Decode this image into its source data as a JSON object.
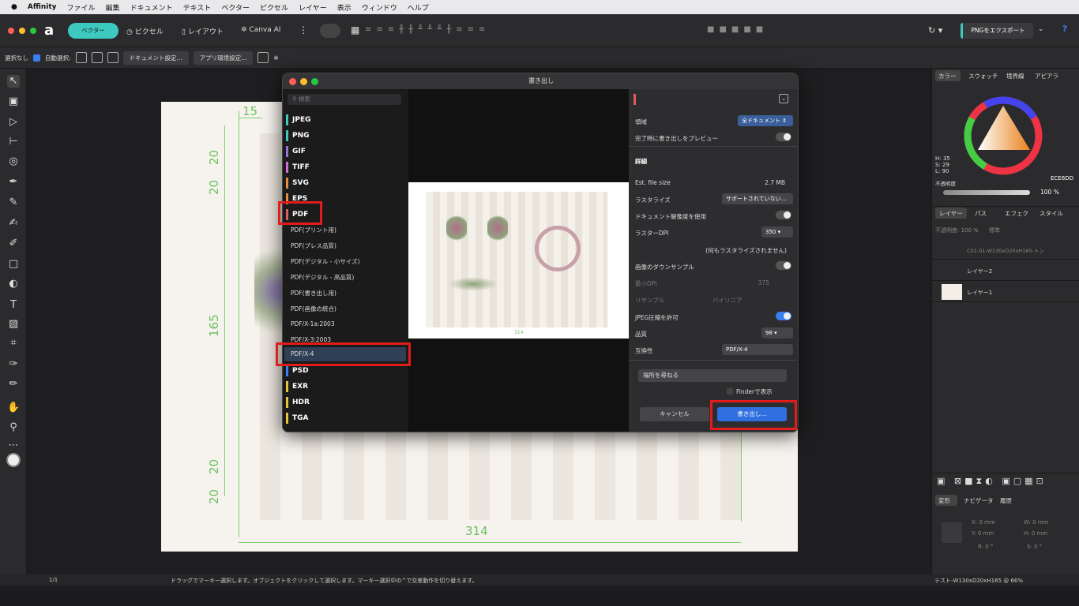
{
  "menubar": {
    "apple": "",
    "app": "Affinity",
    "items": [
      "ファイル",
      "編集",
      "ドキュメント",
      "テキスト",
      "ベクター",
      "ピクセル",
      "レイヤー",
      "表示",
      "ウィンドウ",
      "ヘルプ"
    ]
  },
  "toolbar": {
    "vector": "ベクター",
    "pixel": "ピクセル",
    "layout": "レイアウト",
    "canva": "Canva AI",
    "export": "PNGをエクスポート"
  },
  "context": {
    "select": "選択なし",
    "auto": "自動選択:",
    "docsettings": "ドキュメント設定...",
    "prefs": "アプリ環境設定..."
  },
  "canvas": {
    "dim_left_top": "15",
    "dim_20a": "20",
    "dim_20b": "20",
    "dim_165": "165",
    "dim_20c": "20",
    "dim_20d": "20",
    "dim_bottom": "314"
  },
  "dialog": {
    "title": "書き出し",
    "search_placeholder": "検索",
    "formats": [
      {
        "label": "JPEG",
        "color": "#3ec9c0"
      },
      {
        "label": "PNG",
        "color": "#3ec9c0"
      },
      {
        "label": "GIF",
        "color": "#9b6be0"
      },
      {
        "label": "TIFF",
        "color": "#d46bd8"
      },
      {
        "label": "SVG",
        "color": "#e88b3c"
      },
      {
        "label": "EPS",
        "color": "#e88b3c"
      },
      {
        "label": "PDF",
        "color": "#e05d5d"
      }
    ],
    "pdf_presets": [
      "PDF(プリント用)",
      "PDF(プレス品質)",
      "PDF(デジタル - 小サイズ)",
      "PDF(デジタル - 高品質)",
      "PDF(書き出し用)",
      "PDF(画像の統合)",
      "PDF/X-1a:2003",
      "PDF/X-3:2003",
      "PDF/X-4"
    ],
    "formats_after": [
      {
        "label": "PSD",
        "color": "#3a7ff0"
      },
      {
        "label": "EXR",
        "color": "#e8c23c"
      },
      {
        "label": "HDR",
        "color": "#e8c23c"
      },
      {
        "label": "TGA",
        "color": "#e8c23c"
      }
    ],
    "preview_dim": "314",
    "settings": {
      "area_label": "領域",
      "area_value": "全ドキュメント",
      "preview_label": "完了時に書き出しをプレビュー",
      "details": "詳細",
      "filesize_label": "Est. file size",
      "filesize_value": "2.7 MB",
      "rasterize_label": "ラスタライズ",
      "rasterize_value": "サポートされていない…",
      "docres_label": "ドキュメント解像度を使用",
      "dpi_label": "ラスターDPI",
      "dpi_value": "350",
      "norast": "(何もラスタライズされません)",
      "downsample_label": "画像のダウンサンプル",
      "mindpi_label": "最小DPI",
      "mindpi_value": "375",
      "resample_label": "リサンプル",
      "resample_value": "バイリニア",
      "jpeg_label": "JPEG圧縮を許可",
      "quality_label": "品質",
      "quality_value": "98",
      "compat_label": "互換性",
      "compat_value": "PDF/X-4",
      "ask_place": "場所を尋ねる",
      "finder": "Finderで表示",
      "cancel": "キャンセル",
      "export": "書き出し..."
    }
  },
  "rightpanel": {
    "tabs": [
      "カラー",
      "スウォッチ",
      "境界線",
      "アピアラ"
    ],
    "hsl": [
      "H: 35",
      "S: 29",
      "L: 90"
    ],
    "opacity_label": "不透明度",
    "hex": "ECE6DD",
    "pct": "100 %",
    "layer_tabs": [
      "レイヤー",
      "パス",
      "エフェク",
      "スタイル"
    ],
    "blend": "不透明度: 100 %",
    "normal": "標準",
    "layers": [
      "C01-01-W130xD20xH165-トン",
      "レイヤー2",
      "レイヤー1"
    ],
    "transform_tabs": [
      "変形",
      "ナビゲータ",
      "履歴"
    ],
    "x": "X: 0 mm",
    "y": "Y: 0 mm",
    "w": "W: 0 mm",
    "h": "H: 0 mm",
    "r": "R: 0 °",
    "s": "S: 0 °"
  },
  "status": {
    "page": "1/1",
    "hint": "ドラッグでマーキー選択します。オブジェクトをクリックして選択します。マーキー選択中の^で交差動作を切り替えます。",
    "doc": "テスト-W130xD20xH165 @ 66%"
  },
  "colors": {
    "accent": "#3a7ff0",
    "highlight": "#e21b1b",
    "dim_green": "#6bbf5e"
  }
}
